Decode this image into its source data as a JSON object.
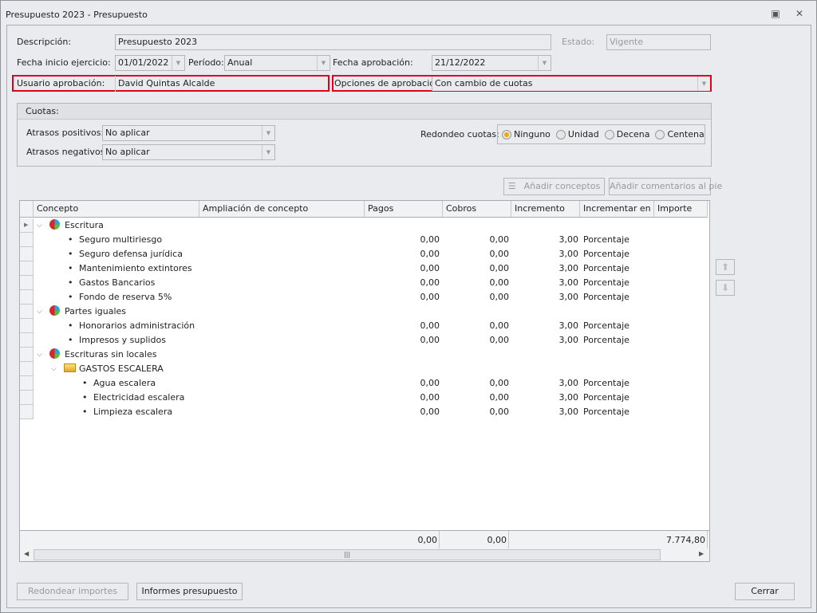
{
  "window": {
    "title": "Presupuesto 2023 - Presupuesto"
  },
  "form": {
    "descripcion_label": "Descripción:",
    "descripcion": "Presupuesto 2023",
    "estado_label": "Estado:",
    "estado": "Vigente",
    "fecha_inicio_label": "Fecha inicio ejercicio:",
    "fecha_inicio": "01/01/2022",
    "periodo_label": "Período:",
    "periodo": "Anual",
    "fecha_aprobacion_label": "Fecha aprobación:",
    "fecha_aprobacion": "21/12/2022",
    "usuario_label": "Usuario aprobación:",
    "usuario": "David Quintas Alcalde",
    "opciones_label": "Opciones de aprobación:",
    "opciones": "Con cambio de cuotas"
  },
  "cuotas": {
    "title": "Cuotas:",
    "positivos_label": "Atrasos positivos:",
    "positivos": "No aplicar",
    "negativos_label": "Atrasos negativos:",
    "negativos": "No aplicar",
    "redondeo_label": "Redondeo cuotas:",
    "options": [
      "Ninguno",
      "Unidad",
      "Decena",
      "Centena"
    ],
    "selected": "Ninguno"
  },
  "toolbar": {
    "add_concepts": "Añadir conceptos",
    "add_comments": "Añadir comentarios al pie"
  },
  "grid": {
    "columns": [
      "Concepto",
      "Ampliación de concepto",
      "Pagos",
      "Cobros",
      "Incremento",
      "Incrementar en",
      "Importe"
    ],
    "rows": [
      {
        "type": "group",
        "concepto": "Escritura"
      },
      {
        "type": "item",
        "concepto": "Seguro multiriesgo",
        "pagos": "0,00",
        "cobros": "0,00",
        "incremento": "3,00",
        "en": "Porcentaje"
      },
      {
        "type": "item",
        "concepto": "Seguro defensa jurídica",
        "pagos": "0,00",
        "cobros": "0,00",
        "incremento": "3,00",
        "en": "Porcentaje"
      },
      {
        "type": "item",
        "concepto": "Mantenimiento extintores",
        "pagos": "0,00",
        "cobros": "0,00",
        "incremento": "3,00",
        "en": "Porcentaje"
      },
      {
        "type": "item",
        "concepto": "Gastos Bancarios",
        "pagos": "0,00",
        "cobros": "0,00",
        "incremento": "3,00",
        "en": "Porcentaje"
      },
      {
        "type": "item",
        "concepto": "Fondo de reserva 5%",
        "pagos": "0,00",
        "cobros": "0,00",
        "incremento": "3,00",
        "en": "Porcentaje"
      },
      {
        "type": "group",
        "concepto": "Partes iguales"
      },
      {
        "type": "item",
        "concepto": "Honorarios administración",
        "pagos": "0,00",
        "cobros": "0,00",
        "incremento": "3,00",
        "en": "Porcentaje"
      },
      {
        "type": "item",
        "concepto": "Impresos y suplidos",
        "pagos": "0,00",
        "cobros": "0,00",
        "incremento": "3,00",
        "en": "Porcentaje"
      },
      {
        "type": "group",
        "concepto": "Escrituras sin locales"
      },
      {
        "type": "folder",
        "concepto": "GASTOS ESCALERA"
      },
      {
        "type": "subitem",
        "concepto": "Agua escalera",
        "pagos": "0,00",
        "cobros": "0,00",
        "incremento": "3,00",
        "en": "Porcentaje"
      },
      {
        "type": "subitem",
        "concepto": "Electricidad escalera",
        "pagos": "0,00",
        "cobros": "0,00",
        "incremento": "3,00",
        "en": "Porcentaje"
      },
      {
        "type": "subitem",
        "concepto": "Limpieza escalera",
        "pagos": "0,00",
        "cobros": "0,00",
        "incremento": "3,00",
        "en": "Porcentaje"
      }
    ],
    "totals": {
      "pagos": "0,00",
      "cobros": "0,00",
      "importe": "7.774,80"
    }
  },
  "footer": {
    "redondear": "Redondear importes",
    "informes": "Informes presupuesto",
    "cerrar": "Cerrar"
  }
}
